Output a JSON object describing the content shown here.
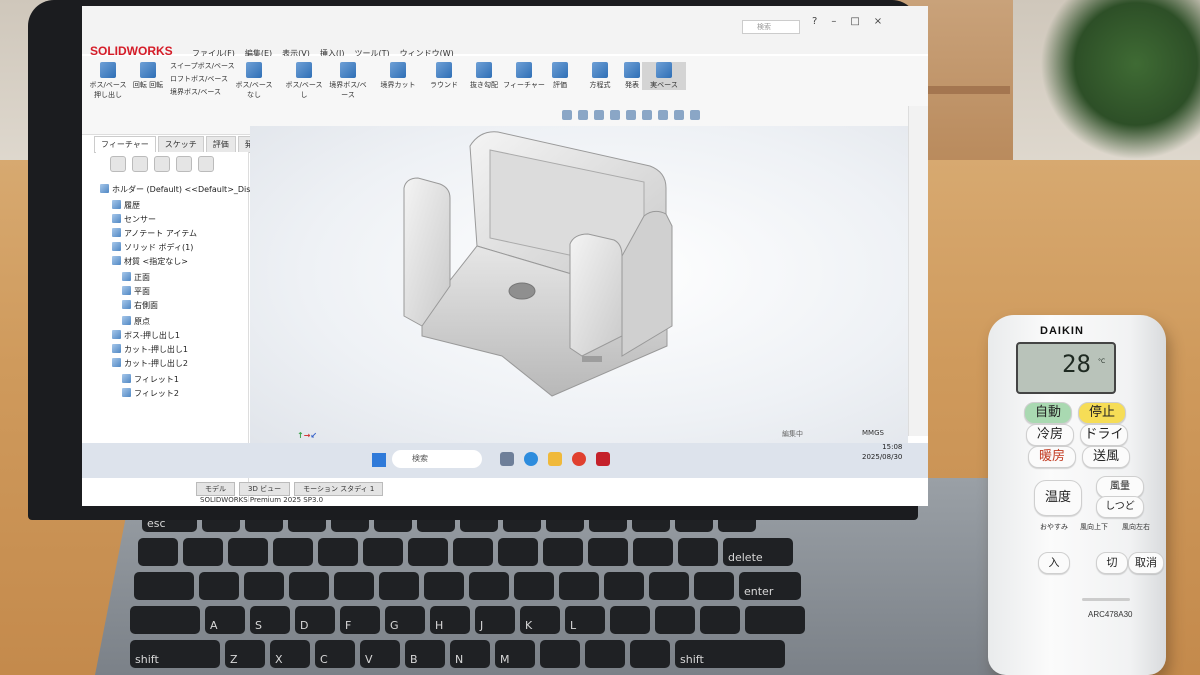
{
  "scene": {
    "description_colors": {
      "wood": "#cf9a5c",
      "wall": "#e2dcd2",
      "laptop": "#1b1c1f",
      "remote": "#f4f5f6"
    }
  },
  "solidworks": {
    "app_logo": "SOLIDWORKS",
    "brand_color": "#d51c28",
    "menu": [
      "ファイル(F)",
      "編集(E)",
      "表示(V)",
      "挿入(I)",
      "ツール(T)",
      "ウィンドウ(W)"
    ],
    "search_placeholder": "検索",
    "ribbon_buttons": [
      {
        "label": "ボス/ベース 押し出し"
      },
      {
        "label": "回転 回転"
      },
      {
        "label": "ボス/ベース ロフト"
      },
      {
        "label": "ボス/ベース なし"
      },
      {
        "label": "ボス/ベース し"
      },
      {
        "label": "境界ボス/ベース"
      },
      {
        "label": "境界カット"
      },
      {
        "label": "ラウンド"
      },
      {
        "label": "抜き勾配"
      },
      {
        "label": "フィーチャー"
      },
      {
        "label": "評価"
      },
      {
        "label": "方程式"
      },
      {
        "label": "発表"
      },
      {
        "label": "実ベース"
      }
    ],
    "ribbon_sub_items": [
      "スイープボス/ベース",
      "ロフトボス/ベース",
      "境界ボス/ベース"
    ],
    "ribbon_tabs": [
      "フィーチャー",
      "スケッチ",
      "評価",
      "発表"
    ],
    "active_ribbon_tab": 0,
    "tree": {
      "root": "ホルダー (Default) <<Default>_Dis",
      "items": [
        "履歴",
        "センサー",
        "アノテート アイテム",
        "ソリッド ボディ(1)",
        "材質 <指定なし>",
        "正面",
        "平面",
        "右側面",
        "原点",
        "ボス-押し出し1",
        "カット-押し出し1",
        "カット-押し出し2",
        "フィレット1",
        "フィレット2"
      ]
    },
    "bottom_tabs": [
      "モデル",
      "3D ビュー",
      "モーション スタディ 1"
    ],
    "status_version": "SOLIDWORKS Premium 2025 SP3.0",
    "status_units": "MMGS",
    "status_editing": "編集中"
  },
  "taskbar": {
    "search_placeholder": "検索",
    "clock_time": "15:08",
    "clock_date": "2025/08/30"
  },
  "remote": {
    "brand": "DAIKIN",
    "temperature": "28",
    "temperature_unit": "°C",
    "buttons": [
      "自動",
      "停止",
      "冷房",
      "ドライ",
      "暖房",
      "送風",
      "温度",
      "風量",
      "しつど"
    ],
    "small_buttons": [
      "おやすみ",
      "風向上下",
      "風向左右",
      "入",
      "切",
      "取消"
    ],
    "model": "ARC478A30"
  }
}
